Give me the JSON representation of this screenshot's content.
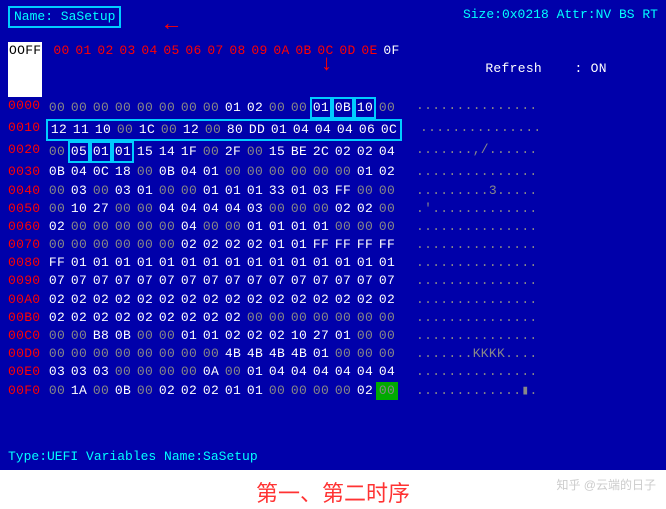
{
  "header": {
    "name_label": "Name: SaSetup",
    "size_attr": "Size:0x0218 Attr:NV BS RT"
  },
  "refresh": {
    "label": "Refresh",
    "sep": ":",
    "value": "ON"
  },
  "footer": {
    "type": "Type:UEFI Variables",
    "name": "Name:SaSetup"
  },
  "caption": "第一、第二时序",
  "watermark": "知乎 @云端的日子",
  "column_header_prefix": "OOFF",
  "columns": [
    "00",
    "01",
    "02",
    "03",
    "04",
    "05",
    "06",
    "07",
    "08",
    "09",
    "0A",
    "0B",
    "0C",
    "0D",
    "0E",
    "0F"
  ],
  "rows": [
    {
      "off": "0000",
      "b": [
        "00",
        "00",
        "00",
        "00",
        "00",
        "00",
        "00",
        "00",
        "01",
        "02",
        "00",
        "00",
        "01",
        "0B",
        "10",
        "00"
      ],
      "a": "..............."
    },
    {
      "off": "0010",
      "b": [
        "12",
        "11",
        "10",
        "00",
        "1C",
        "00",
        "12",
        "00",
        "80",
        "DD",
        "01",
        "04",
        "04",
        "04",
        "06",
        "0C"
      ],
      "a": "..............."
    },
    {
      "off": "0020",
      "b": [
        "00",
        "05",
        "01",
        "01",
        "15",
        "14",
        "1F",
        "00",
        "2F",
        "00",
        "15",
        "BE",
        "2C",
        "02",
        "02",
        "04"
      ],
      "a": ".......,/......"
    },
    {
      "off": "0030",
      "b": [
        "0B",
        "04",
        "0C",
        "18",
        "00",
        "0B",
        "04",
        "01",
        "00",
        "00",
        "00",
        "00",
        "00",
        "00",
        "01",
        "02"
      ],
      "a": "..............."
    },
    {
      "off": "0040",
      "b": [
        "00",
        "03",
        "00",
        "03",
        "01",
        "00",
        "00",
        "01",
        "01",
        "01",
        "33",
        "01",
        "03",
        "FF",
        "00",
        "00"
      ],
      "a": ".........3....."
    },
    {
      "off": "0050",
      "b": [
        "00",
        "10",
        "27",
        "00",
        "00",
        "04",
        "04",
        "04",
        "04",
        "03",
        "00",
        "00",
        "00",
        "02",
        "02",
        "00"
      ],
      "a": ".'............."
    },
    {
      "off": "0060",
      "b": [
        "02",
        "00",
        "00",
        "00",
        "00",
        "00",
        "04",
        "00",
        "00",
        "01",
        "01",
        "01",
        "01",
        "00",
        "00",
        "00"
      ],
      "a": "..............."
    },
    {
      "off": "0070",
      "b": [
        "00",
        "00",
        "00",
        "00",
        "00",
        "00",
        "02",
        "02",
        "02",
        "02",
        "01",
        "01",
        "FF",
        "FF",
        "FF",
        "FF"
      ],
      "a": "..............."
    },
    {
      "off": "0080",
      "b": [
        "FF",
        "01",
        "01",
        "01",
        "01",
        "01",
        "01",
        "01",
        "01",
        "01",
        "01",
        "01",
        "01",
        "01",
        "01",
        "01"
      ],
      "a": "..............."
    },
    {
      "off": "0090",
      "b": [
        "07",
        "07",
        "07",
        "07",
        "07",
        "07",
        "07",
        "07",
        "07",
        "07",
        "07",
        "07",
        "07",
        "07",
        "07",
        "07"
      ],
      "a": "..............."
    },
    {
      "off": "00A0",
      "b": [
        "02",
        "02",
        "02",
        "02",
        "02",
        "02",
        "02",
        "02",
        "02",
        "02",
        "02",
        "02",
        "02",
        "02",
        "02",
        "02"
      ],
      "a": "..............."
    },
    {
      "off": "00B0",
      "b": [
        "02",
        "02",
        "02",
        "02",
        "02",
        "02",
        "02",
        "02",
        "02",
        "00",
        "00",
        "00",
        "00",
        "00",
        "00",
        "00"
      ],
      "a": "..............."
    },
    {
      "off": "00C0",
      "b": [
        "00",
        "00",
        "B8",
        "0B",
        "00",
        "00",
        "01",
        "01",
        "02",
        "02",
        "02",
        "10",
        "27",
        "01",
        "00",
        "00"
      ],
      "a": "..............."
    },
    {
      "off": "00D0",
      "b": [
        "00",
        "00",
        "00",
        "00",
        "00",
        "00",
        "00",
        "00",
        "4B",
        "4B",
        "4B",
        "4B",
        "01",
        "00",
        "00",
        "00"
      ],
      "a": ".......KKKK...."
    },
    {
      "off": "00E0",
      "b": [
        "03",
        "03",
        "03",
        "00",
        "00",
        "00",
        "00",
        "0A",
        "00",
        "01",
        "04",
        "04",
        "04",
        "04",
        "04",
        "04"
      ],
      "a": "..............."
    },
    {
      "off": "00F0",
      "b": [
        "00",
        "1A",
        "00",
        "0B",
        "00",
        "02",
        "02",
        "02",
        "01",
        "01",
        "00",
        "00",
        "00",
        "00",
        "02",
        "00"
      ],
      "a": ".............▮."
    }
  ],
  "highlights": {
    "row0_cols": [
      12,
      13,
      14
    ],
    "row1_full": true,
    "row2_cols": [
      1,
      2,
      3
    ],
    "rowF_green_col": 15
  }
}
